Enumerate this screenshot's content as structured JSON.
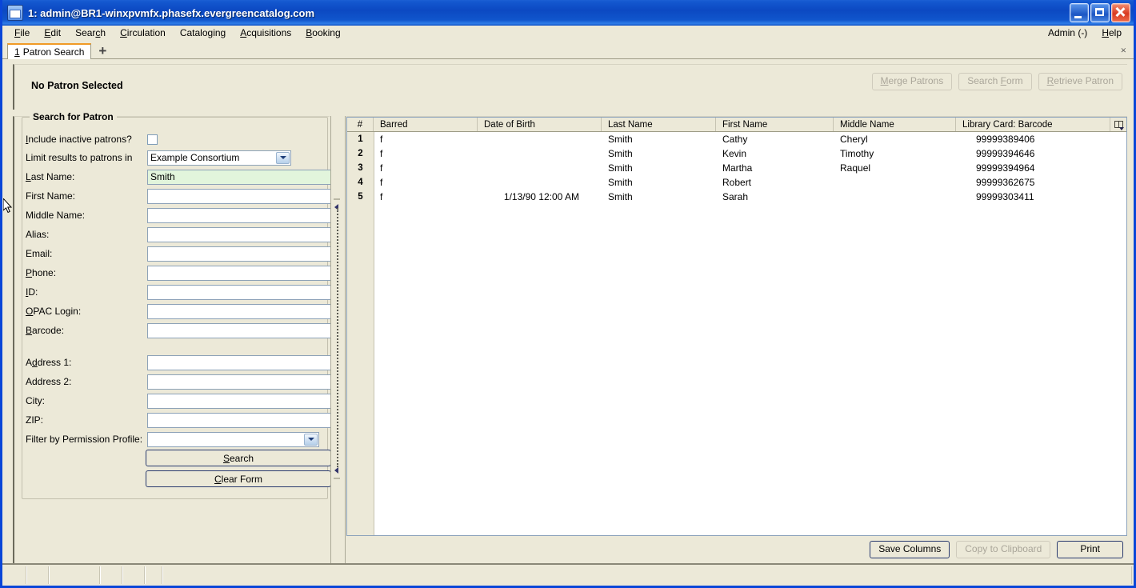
{
  "window": {
    "title": "1: admin@BR1-winxpvmfx.phasefx.evergreencatalog.com",
    "icon": "window-icon",
    "controls": {
      "minimize": "minimize-icon",
      "maximize": "maximize-icon",
      "close": "close-icon"
    }
  },
  "menubar": {
    "items": [
      {
        "label": "File",
        "accel": "F"
      },
      {
        "label": "Edit",
        "accel": "E"
      },
      {
        "label": "Search",
        "accel": "c"
      },
      {
        "label": "Circulation",
        "accel": "C"
      },
      {
        "label": "Cataloging",
        "accel": "g"
      },
      {
        "label": "Acquisitions",
        "accel": "A"
      },
      {
        "label": "Booking",
        "accel": "B"
      }
    ],
    "right": [
      {
        "label": "Admin (-)",
        "accel": ""
      },
      {
        "label": "Help",
        "accel": "H"
      }
    ]
  },
  "tabs": {
    "items": [
      {
        "number": "1",
        "label": "Patron Search"
      }
    ],
    "add_label": "+",
    "close_label": "×"
  },
  "patron_header": {
    "title": "No Patron Selected",
    "buttons": [
      {
        "label": "Merge Patrons",
        "enabled": false
      },
      {
        "label": "Search Form",
        "enabled": false
      },
      {
        "label": "Retrieve Patron",
        "enabled": false
      }
    ]
  },
  "search_form": {
    "legend": "Search for Patron",
    "include_inactive": {
      "label": "Include inactive patrons?",
      "checked": false
    },
    "limit_results": {
      "label": "Limit results to patrons in",
      "value": "Example Consortium"
    },
    "fields": [
      {
        "label": "Last Name:",
        "value": "Smith",
        "focused": true
      },
      {
        "label": "First Name:",
        "value": "",
        "focused": false
      },
      {
        "label": "Middle Name:",
        "value": "",
        "focused": false
      },
      {
        "label": "Alias:",
        "value": "",
        "focused": false
      },
      {
        "label": "Email:",
        "value": "",
        "focused": false
      },
      {
        "label": "Phone:",
        "value": "",
        "focused": false
      },
      {
        "label": "ID:",
        "value": "",
        "focused": false
      },
      {
        "label": "OPAC Login:",
        "value": "",
        "focused": false
      },
      {
        "label": "Barcode:",
        "value": "",
        "focused": false
      }
    ],
    "address_fields": [
      {
        "label": "Address 1:",
        "value": ""
      },
      {
        "label": "Address 2:",
        "value": ""
      },
      {
        "label": "City:",
        "value": ""
      },
      {
        "label": "ZIP:",
        "value": ""
      }
    ],
    "permission_profile": {
      "label": "Filter by Permission Profile:",
      "value": ""
    },
    "search_button": "Search",
    "clear_button": "Clear Form"
  },
  "results": {
    "columns": [
      {
        "key": "num",
        "label": "#"
      },
      {
        "key": "barred",
        "label": "Barred"
      },
      {
        "key": "dob",
        "label": "Date of Birth"
      },
      {
        "key": "last",
        "label": "Last Name"
      },
      {
        "key": "first",
        "label": "First Name"
      },
      {
        "key": "middle",
        "label": "Middle Name"
      },
      {
        "key": "barcode",
        "label": "Library Card: Barcode"
      }
    ],
    "column_picker_icon": "column-picker-icon",
    "rows": [
      {
        "num": "1",
        "barred": "f",
        "dob": "",
        "last": "Smith",
        "first": "Cathy",
        "middle": "Cheryl",
        "barcode": "99999389406"
      },
      {
        "num": "2",
        "barred": "f",
        "dob": "",
        "last": "Smith",
        "first": "Kevin",
        "middle": "Timothy",
        "barcode": "99999394646"
      },
      {
        "num": "3",
        "barred": "f",
        "dob": "",
        "last": "Smith",
        "first": "Martha",
        "middle": "Raquel",
        "barcode": "99999394964"
      },
      {
        "num": "4",
        "barred": "f",
        "dob": "",
        "last": "Smith",
        "first": "Robert",
        "middle": "",
        "barcode": "99999362675"
      },
      {
        "num": "5",
        "barred": "f",
        "dob": "1/13/90 12:00 AM",
        "last": "Smith",
        "first": "Sarah",
        "middle": "",
        "barcode": "99999303411"
      }
    ],
    "footer_buttons": [
      {
        "label": "Save Columns",
        "enabled": true
      },
      {
        "label": "Copy to Clipboard",
        "enabled": false
      },
      {
        "label": "Print",
        "enabled": true
      }
    ]
  },
  "statusbar": {
    "segments": [
      "",
      "",
      "",
      "",
      "",
      "",
      ""
    ]
  },
  "colors": {
    "title_blue": "#0c49c2",
    "face": "#ece9d8",
    "focused_field": "#e2f5dc",
    "tab_accent": "#f09a26",
    "field_border": "#8da2b8"
  }
}
